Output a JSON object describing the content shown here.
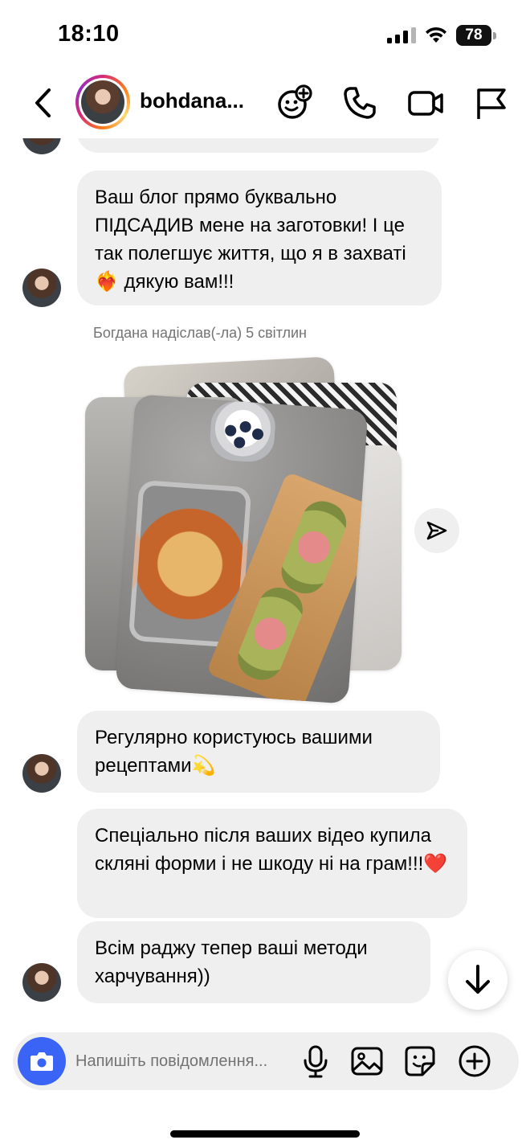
{
  "status_bar": {
    "time": "18:10",
    "battery_level": "78"
  },
  "header": {
    "username": "bohdana...",
    "icons": [
      "back-chevron-icon",
      "games-emoji-icon",
      "phone-icon",
      "video-camera-icon",
      "flag-icon"
    ]
  },
  "messages": [
    {
      "text": "Ваш блог прямо буквально ПІДСАДИВ мене на заготовки! І це так полегшує життя, що я в захваті❤️‍🔥 дякую вам!!!"
    },
    {
      "text": "Регулярно користуюсь вашими рецептами💫"
    },
    {
      "text": "Спеціально після ваших відео купила скляні форми і не шкоду ні на грам!!!❤️"
    },
    {
      "text": "Всім раджу тепер ваші методи харчування))"
    }
  ],
  "photo_note": "Богдана надіслав(-ла) 5 світлин",
  "composer": {
    "placeholder": "Напишіть повідомлення...",
    "icons": [
      "camera-icon",
      "microphone-icon",
      "gallery-icon",
      "sticker-icon",
      "plus-circle-icon"
    ]
  }
}
